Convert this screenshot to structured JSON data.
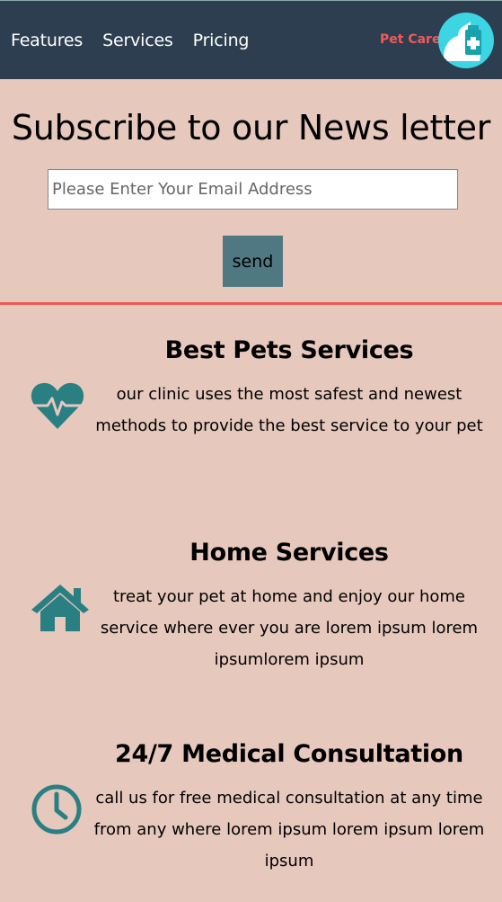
{
  "nav": {
    "links": [
      "Features",
      "Services",
      "Pricing"
    ],
    "brand": "Pet Care"
  },
  "newsletter": {
    "title": "Subscribe to our News letter",
    "email_placeholder": "Please Enter Your Email Address",
    "send_label": "send"
  },
  "services": [
    {
      "icon": "heart-pulse-icon",
      "title": "Best Pets Services",
      "text": "our clinic uses the most safest and newest methods to provide the best service to your pet"
    },
    {
      "icon": "home-icon",
      "title": "Home Services",
      "text": "treat your pet at home and enjoy our home service where ever you are lorem ipsum lorem ipsumlorem ipsum"
    },
    {
      "icon": "clock-icon",
      "title": "24/7 Medical Consultation",
      "text": "call us for free medical consultation at any time from any where lorem ipsum lorem ipsum lorem ipsum"
    }
  ],
  "colors": {
    "navbar": "#2c3e50",
    "background": "#e6c8bd",
    "accent": "#2a7f82",
    "divider": "#ec5a55",
    "brand": "#f15a5a",
    "button": "#4f7882"
  }
}
